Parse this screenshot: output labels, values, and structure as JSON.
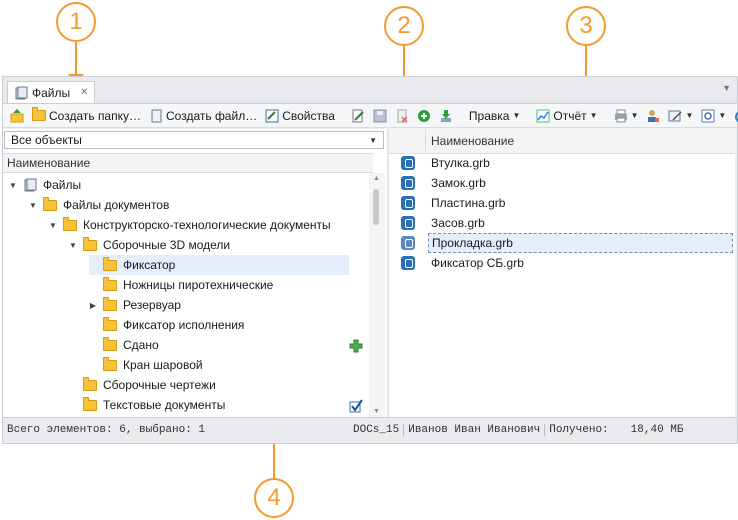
{
  "callouts": [
    "1",
    "2",
    "3",
    "4"
  ],
  "tab": {
    "label": "Файлы",
    "close": "✕"
  },
  "toolbar": {
    "create_folder": "Создать папку…",
    "create_file": "Создать файл…",
    "properties": "Свойства",
    "edit_menu": "Правка",
    "report_menu": "Отчёт"
  },
  "left": {
    "filter_value": "Все объекты",
    "header": "Наименование",
    "tree": [
      {
        "label": "Файлы",
        "toggle": "▼",
        "icon": "files-root-icon"
      },
      {
        "label": "Файлы документов",
        "toggle": "▼",
        "icon": "folder-icon"
      },
      {
        "label": "Конструкторско-технологические документы",
        "toggle": "▼",
        "icon": "folder-icon"
      },
      {
        "label": "Сборочные 3D модели",
        "toggle": "▼",
        "icon": "folder-icon"
      },
      {
        "label": "Фиксатор",
        "toggle": "",
        "icon": "folder-icon"
      },
      {
        "label": "Ножницы пиротехнические",
        "toggle": "",
        "icon": "folder-icon"
      },
      {
        "label": "Резервуар",
        "toggle": "▶",
        "icon": "folder-icon"
      },
      {
        "label": "Фиксатор исполнения",
        "toggle": "",
        "icon": "folder-icon"
      },
      {
        "label": "Сдано",
        "toggle": "",
        "icon": "folder-icon"
      },
      {
        "label": "Кран шаровой",
        "toggle": "",
        "icon": "folder-icon"
      },
      {
        "label": "Сборочные чертежи",
        "toggle": "",
        "icon": "folder-icon"
      },
      {
        "label": "Текстовые документы",
        "toggle": "",
        "icon": "folder-icon"
      }
    ]
  },
  "right": {
    "header": "Наименование",
    "files": [
      {
        "name": "Втулка.grb"
      },
      {
        "name": "Замок.grb"
      },
      {
        "name": "Пластина.grb"
      },
      {
        "name": "Засов.grb"
      },
      {
        "name": "Прокладка.grb"
      },
      {
        "name": "Фиксатор СБ.grb"
      }
    ]
  },
  "status": {
    "count": "Всего элементов: 6, выбрано: 1",
    "server": "DOCs_15",
    "user": "Иванов Иван Иванович",
    "received_label": "Получено:",
    "received_value": "18,40 МБ"
  },
  "colors": {
    "accent_orange": "#f29a2e",
    "folder": "#f6c338",
    "file_icon": "#2a6fb6",
    "selection": "#e5eefa"
  }
}
